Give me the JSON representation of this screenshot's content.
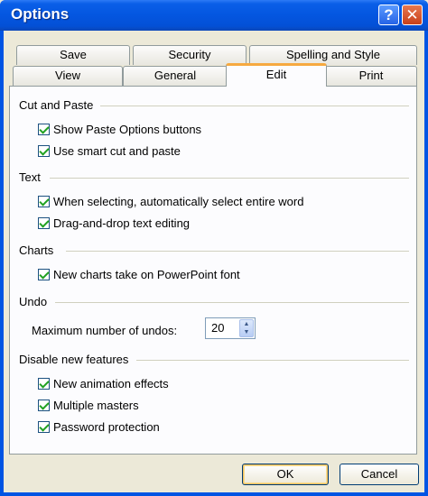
{
  "window": {
    "title": "Options"
  },
  "titlebar": {
    "help_glyph": "?",
    "close_glyph": "✕"
  },
  "tabs": {
    "row_back": [
      "Save",
      "Security",
      "Spelling and Style"
    ],
    "row_front": [
      "View",
      "General",
      "Edit",
      "Print"
    ],
    "active": "Edit"
  },
  "groups": {
    "cut_paste": {
      "label": "Cut and Paste",
      "items": [
        {
          "label": "Show Paste Options buttons",
          "checked": true
        },
        {
          "label": "Use smart cut and paste",
          "checked": true
        }
      ]
    },
    "text": {
      "label": "Text",
      "items": [
        {
          "label": "When selecting, automatically select entire word",
          "checked": true
        },
        {
          "label": "Drag-and-drop text editing",
          "checked": true
        }
      ]
    },
    "charts": {
      "label": "Charts",
      "items": [
        {
          "label": "New charts take on PowerPoint font",
          "checked": true
        }
      ]
    },
    "undo": {
      "label": "Undo",
      "max_label": "Maximum number of undos:",
      "max_value": "20"
    },
    "disable": {
      "label": "Disable new features",
      "items": [
        {
          "label": "New animation effects",
          "checked": true
        },
        {
          "label": "Multiple masters",
          "checked": true
        },
        {
          "label": "Password protection",
          "checked": true
        }
      ]
    }
  },
  "buttons": {
    "ok": "OK",
    "cancel": "Cancel"
  }
}
